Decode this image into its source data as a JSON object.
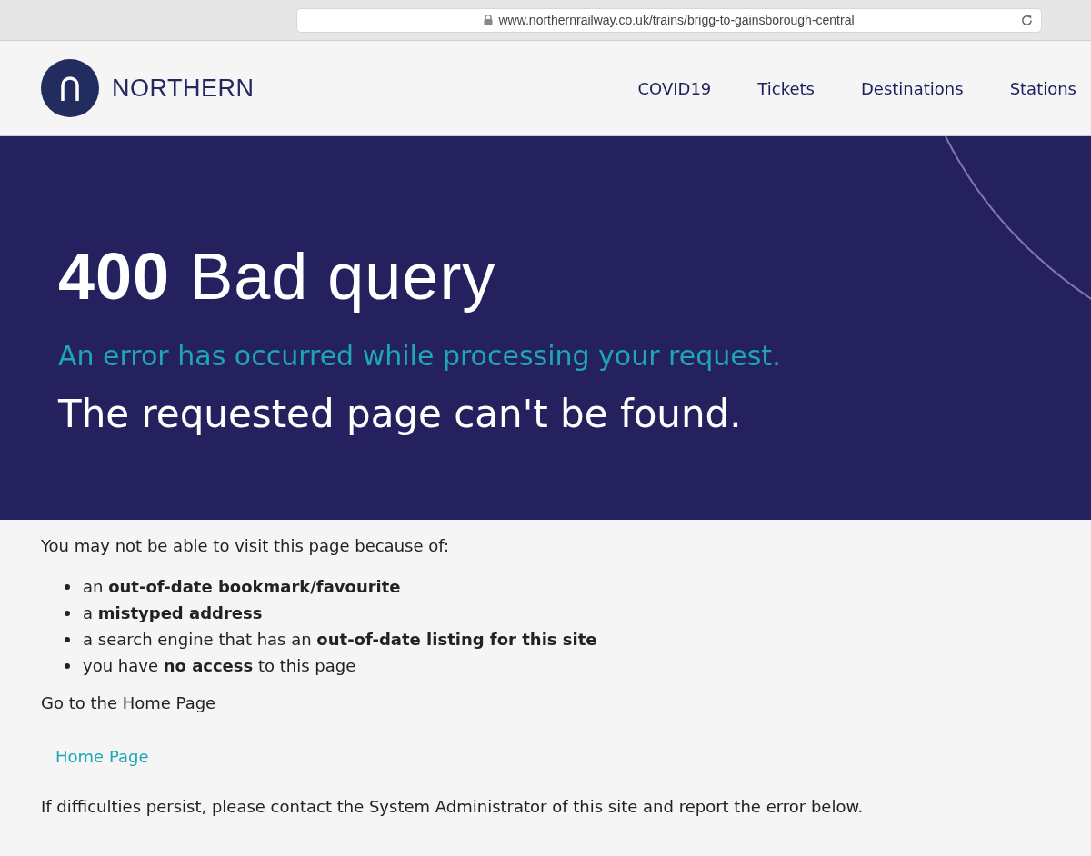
{
  "browser": {
    "url": "www.northernrailway.co.uk/trains/brigg-to-gainsborough-central"
  },
  "header": {
    "logo_text": "NORTHERN",
    "nav": [
      "COVID19",
      "Tickets",
      "Destinations",
      "Stations"
    ]
  },
  "hero": {
    "title": "**400** Bad query",
    "subtitle": "An error has occurred while processing your request.",
    "message": "The requested page can't be found."
  },
  "content": {
    "intro": "You may not be able to visit this page because of:",
    "reasons": [
      "an **out-of-date bookmark/favourite**",
      "a **mistyped address**",
      "a search engine that has an **out-of-date listing for this site**",
      "you have **no access** to this page"
    ],
    "home_prompt": "Go to the Home Page",
    "home_link": "Home Page",
    "footer_note": "If difficulties persist, please contact the System Administrator of this site and report the error below."
  }
}
